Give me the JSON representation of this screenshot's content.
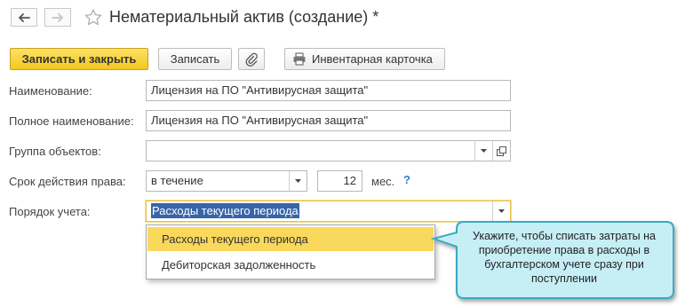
{
  "window": {
    "title": "Нематериальный актив (создание) *"
  },
  "toolbar": {
    "save_close_label": "Записать и закрыть",
    "save_label": "Записать",
    "inventory_card_label": "Инвентарная карточка"
  },
  "form": {
    "name": {
      "label": "Наименование:",
      "value": "Лицензия на ПО \"Антивирусная защита\""
    },
    "full_name": {
      "label": "Полное наименование:",
      "value": "Лицензия на ПО \"Антивирусная защита\""
    },
    "object_group": {
      "label": "Группа объектов:",
      "value": ""
    },
    "validity": {
      "label": "Срок действия права:",
      "mode": "в течение",
      "amount": "12",
      "unit": "мес.",
      "help": "?"
    },
    "accounting_order": {
      "label": "Порядок учета:",
      "value": "Расходы текущего периода"
    }
  },
  "dropdown": {
    "options": [
      "Расходы текущего периода",
      "Дебиторская задолженность"
    ],
    "selected_index": 0
  },
  "callout": {
    "text": "Укажите, чтобы списать затраты на приобретение права в расходы в бухгалтерском учете сразу при поступлении"
  },
  "colors": {
    "primary_button": "#f4c81d",
    "dropdown_highlight": "#f9d85c",
    "callout_fill": "#c6eef5",
    "callout_border": "#3aa9c2",
    "selection": "#3865a8",
    "help": "#2b7ed6",
    "focus_border": "#e8c24a"
  }
}
